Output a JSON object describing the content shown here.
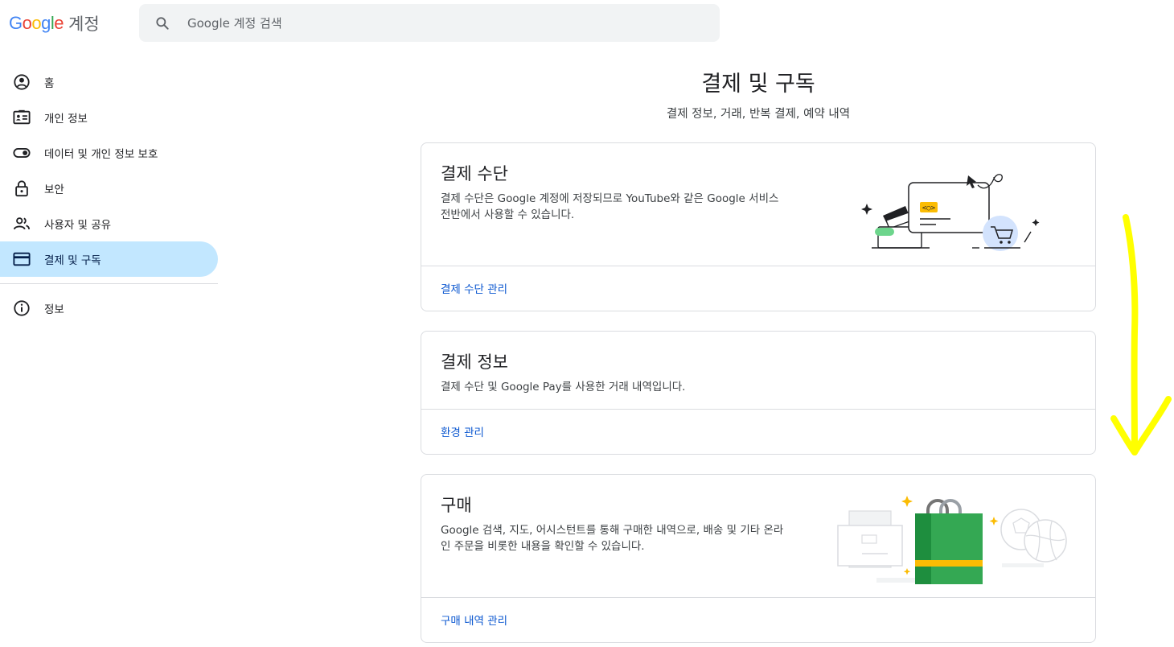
{
  "header": {
    "logo_text": "Google",
    "logo_sub": "계정",
    "search_placeholder": "Google 계정 검색"
  },
  "sidebar": {
    "items": [
      {
        "label": "홈",
        "icon": "account-circle-icon"
      },
      {
        "label": "개인 정보",
        "icon": "id-card-icon"
      },
      {
        "label": "데이터 및 개인 정보 보호",
        "icon": "toggle-icon"
      },
      {
        "label": "보안",
        "icon": "lock-icon"
      },
      {
        "label": "사용자 및 공유",
        "icon": "people-icon"
      },
      {
        "label": "결제 및 구독",
        "icon": "credit-card-icon",
        "active": true
      }
    ],
    "footer_items": [
      {
        "label": "정보",
        "icon": "info-icon"
      }
    ]
  },
  "main": {
    "title": "결제 및 구독",
    "subtitle": "결제 정보, 거래, 반복 결제, 예약 내역",
    "cards": [
      {
        "title": "결제 수단",
        "description_lines": [
          "결제 수단은 Google 계정에 저장되므로 YouTube와 같은 Google 서비스",
          "전반에서 사용할 수 있습니다."
        ],
        "link": "결제 수단 관리",
        "illustration": "payment-methods-illustration"
      },
      {
        "title": "결제 정보",
        "description_lines": [
          "결제 수단 및 Google Pay를 사용한 거래 내역입니다."
        ],
        "link": "환경 관리"
      },
      {
        "title": "구매",
        "description_lines": [
          "Google 검색, 지도, 어시스턴트를 통해 구매한 내역으로, 배송 및 기타 온라",
          "인 주문을 비롯한 내용을 확인할 수 있습니다."
        ],
        "link": "구매 내역 관리",
        "illustration": "purchases-illustration"
      }
    ]
  },
  "colors": {
    "active_nav_bg": "#c2e7ff",
    "link": "#0b57d0",
    "annotation": "#ffff00"
  }
}
